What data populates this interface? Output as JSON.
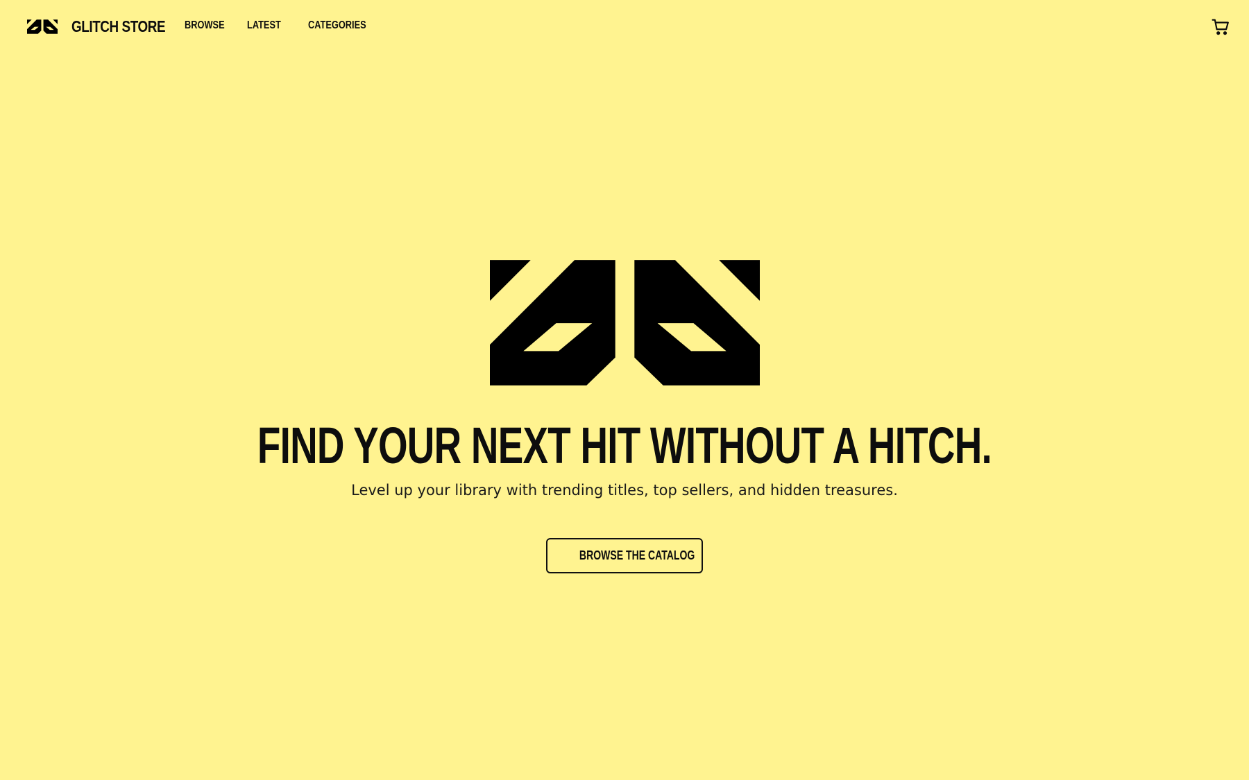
{
  "header": {
    "brand_name": "GLITCH STORE",
    "logo_icon": "glitch-store-logo",
    "nav": {
      "browse": "BROWSE",
      "latest": "LATEST",
      "categories": "CATEGORIES"
    },
    "cart_icon": "shopping-cart-icon"
  },
  "hero": {
    "logo_icon": "glitch-store-logo",
    "headline": "FIND YOUR NEXT HIT WITHOUT A HITCH.",
    "subheadline": "Level up your library with trending titles, top sellers, and hidden treasures.",
    "cta_label": "BROWSE THE CATALOG",
    "cta_icon": "arrow-right-icon"
  },
  "colors": {
    "background": "#fff390",
    "foreground": "#0d0d0d"
  }
}
